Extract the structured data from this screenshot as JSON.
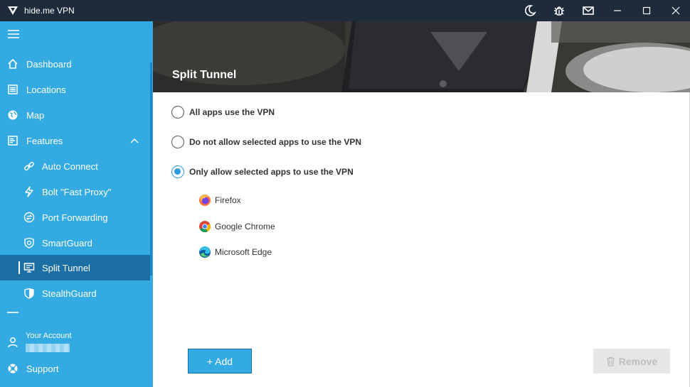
{
  "window": {
    "title": "hide.me VPN",
    "icons": [
      "moon-icon",
      "bug-icon",
      "mail-icon"
    ],
    "controls": [
      "minimize",
      "maximize",
      "close"
    ]
  },
  "sidebar": {
    "items": [
      {
        "label": "Dashboard",
        "icon": "home-icon"
      },
      {
        "label": "Locations",
        "icon": "list-icon"
      },
      {
        "label": "Map",
        "icon": "globe-icon"
      },
      {
        "label": "Features",
        "icon": "features-icon",
        "expanded": true
      },
      {
        "label": "Auto Connect",
        "icon": "link-icon"
      },
      {
        "label": "Bolt \"Fast Proxy\"",
        "icon": "bolt-icon"
      },
      {
        "label": "Port Forwarding",
        "icon": "port-icon"
      },
      {
        "label": "SmartGuard",
        "icon": "smartguard-icon"
      },
      {
        "label": "Split Tunnel",
        "icon": "monitor-icon",
        "active": true
      },
      {
        "label": "StealthGuard",
        "icon": "shield-icon"
      }
    ],
    "account_label": "Your Account",
    "support_label": "Support"
  },
  "page": {
    "title": "Split Tunnel"
  },
  "options": [
    {
      "label": "All apps use the VPN",
      "checked": false
    },
    {
      "label": "Do not allow selected apps to use the VPN",
      "checked": false
    },
    {
      "label": "Only allow selected apps to use the VPN",
      "checked": true
    }
  ],
  "apps": [
    {
      "name": "Firefox",
      "icon": "firefox-icon"
    },
    {
      "name": "Google Chrome",
      "icon": "chrome-icon"
    },
    {
      "name": "Microsoft Edge",
      "icon": "edge-icon"
    }
  ],
  "buttons": {
    "add_label": "+ Add",
    "remove_label": "Remove"
  },
  "colors": {
    "sidebar": "#33aae1",
    "active_item": "#1b6fa5",
    "titlebar": "#1d2b3a",
    "accent": "#2c9bdc"
  }
}
